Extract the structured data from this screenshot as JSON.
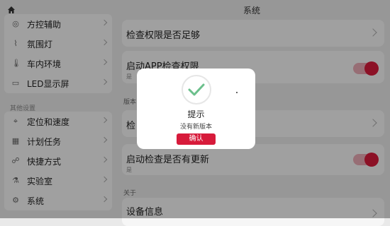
{
  "sidebar": {
    "items_top": [
      {
        "label": "方控辅助",
        "icon": "steering-icon"
      },
      {
        "label": "氛围灯",
        "icon": "ambient-light-icon"
      },
      {
        "label": "车内环境",
        "icon": "thermometer-icon"
      },
      {
        "label": "LED显示屏",
        "icon": "monitor-icon"
      }
    ],
    "section_other": "其他设置",
    "items_other": [
      {
        "label": "定位和速度",
        "icon": "location-icon"
      },
      {
        "label": "计划任务",
        "icon": "calendar-icon"
      },
      {
        "label": "快捷方式",
        "icon": "shortcut-icon"
      },
      {
        "label": "实验室",
        "icon": "flask-icon"
      },
      {
        "label": "系统",
        "icon": "gear-icon"
      }
    ]
  },
  "header": {
    "title": "系统"
  },
  "main": {
    "row_check_permission": "检查权限是否足够",
    "row_launch_check": {
      "title": "启动APP检查权限",
      "sub": "是",
      "toggle_on": true
    },
    "section_version": "版本",
    "row_check_partial": "检",
    "row_startup_update": {
      "title": "启动检查是否有更新",
      "sub": "是",
      "toggle_on": true
    },
    "section_about": "关于",
    "row_device_info": "设备信息"
  },
  "dialog": {
    "title": "提示",
    "message": "没有新版本",
    "confirm_label": "确认",
    "icon": "check-circle-icon"
  },
  "colors": {
    "accent": "#d71b3b",
    "check": "#6cc08c"
  }
}
